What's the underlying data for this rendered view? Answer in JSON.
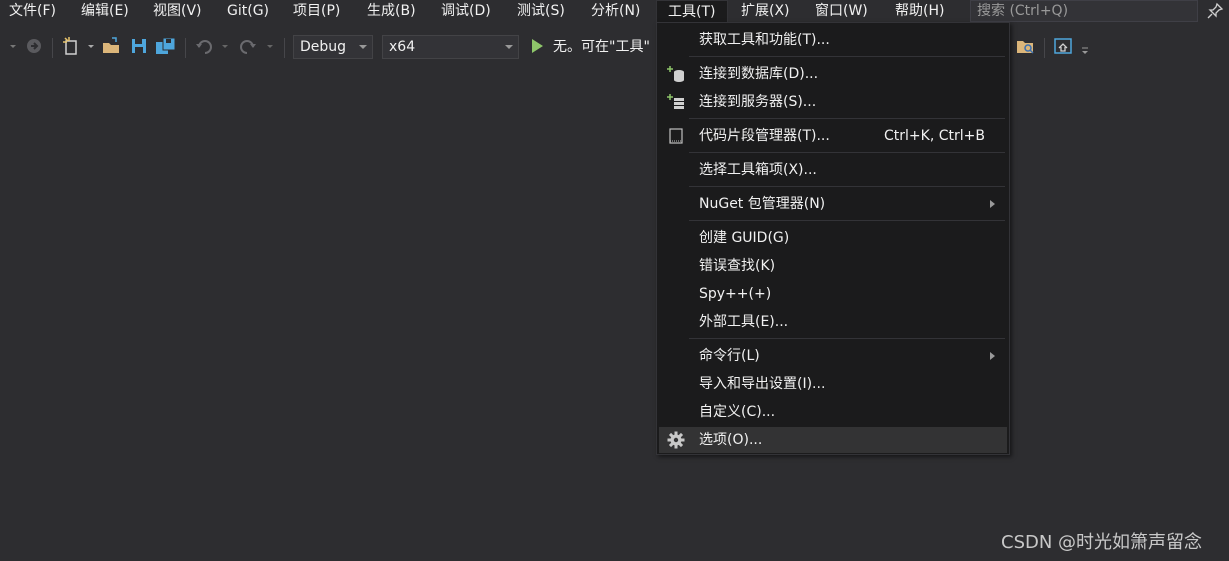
{
  "menubar": {
    "items": [
      "文件(F)",
      "编辑(E)",
      "视图(V)",
      "Git(G)",
      "项目(P)",
      "生成(B)",
      "调试(D)",
      "测试(S)",
      "分析(N)",
      "工具(T)",
      "扩展(X)",
      "窗口(W)",
      "帮助(H)"
    ],
    "open_item": "工具(T)",
    "search_placeholder": "搜索 (Ctrl+Q)"
  },
  "toolbar": {
    "config": "Debug",
    "platform": "x64",
    "run_text": "无。可在\"工具\""
  },
  "tools_menu": {
    "items": [
      {
        "label": "获取工具和功能(T)...",
        "shortcut": "",
        "submenu": false,
        "icon": ""
      },
      {
        "label": "连接到数据库(D)...",
        "shortcut": "",
        "submenu": false,
        "icon": "database-connect-icon"
      },
      {
        "label": "连接到服务器(S)...",
        "shortcut": "",
        "submenu": false,
        "icon": "server-connect-icon"
      },
      {
        "label": "代码片段管理器(T)...",
        "shortcut": "Ctrl+K, Ctrl+B",
        "submenu": false,
        "icon": "snippet-icon"
      },
      {
        "label": "选择工具箱项(X)...",
        "shortcut": "",
        "submenu": false,
        "icon": ""
      },
      {
        "label": "NuGet 包管理器(N)",
        "shortcut": "",
        "submenu": true,
        "icon": ""
      },
      {
        "label": "创建 GUID(G)",
        "shortcut": "",
        "submenu": false,
        "icon": ""
      },
      {
        "label": "错误查找(K)",
        "shortcut": "",
        "submenu": false,
        "icon": ""
      },
      {
        "label": "Spy++(+)",
        "shortcut": "",
        "submenu": false,
        "icon": ""
      },
      {
        "label": "外部工具(E)...",
        "shortcut": "",
        "submenu": false,
        "icon": ""
      },
      {
        "label": "命令行(L)",
        "shortcut": "",
        "submenu": true,
        "icon": ""
      },
      {
        "label": "导入和导出设置(I)...",
        "shortcut": "",
        "submenu": false,
        "icon": ""
      },
      {
        "label": "自定义(C)...",
        "shortcut": "",
        "submenu": false,
        "icon": ""
      },
      {
        "label": "选项(O)...",
        "shortcut": "",
        "submenu": false,
        "icon": "gear-icon",
        "highlighted": true
      }
    ]
  },
  "watermark": "CSDN @时光如箫声留念",
  "colors": {
    "background": "#2d2d30",
    "menu_background": "#1b1b1c",
    "highlight": "#333334",
    "play_green": "#8ec66a"
  }
}
